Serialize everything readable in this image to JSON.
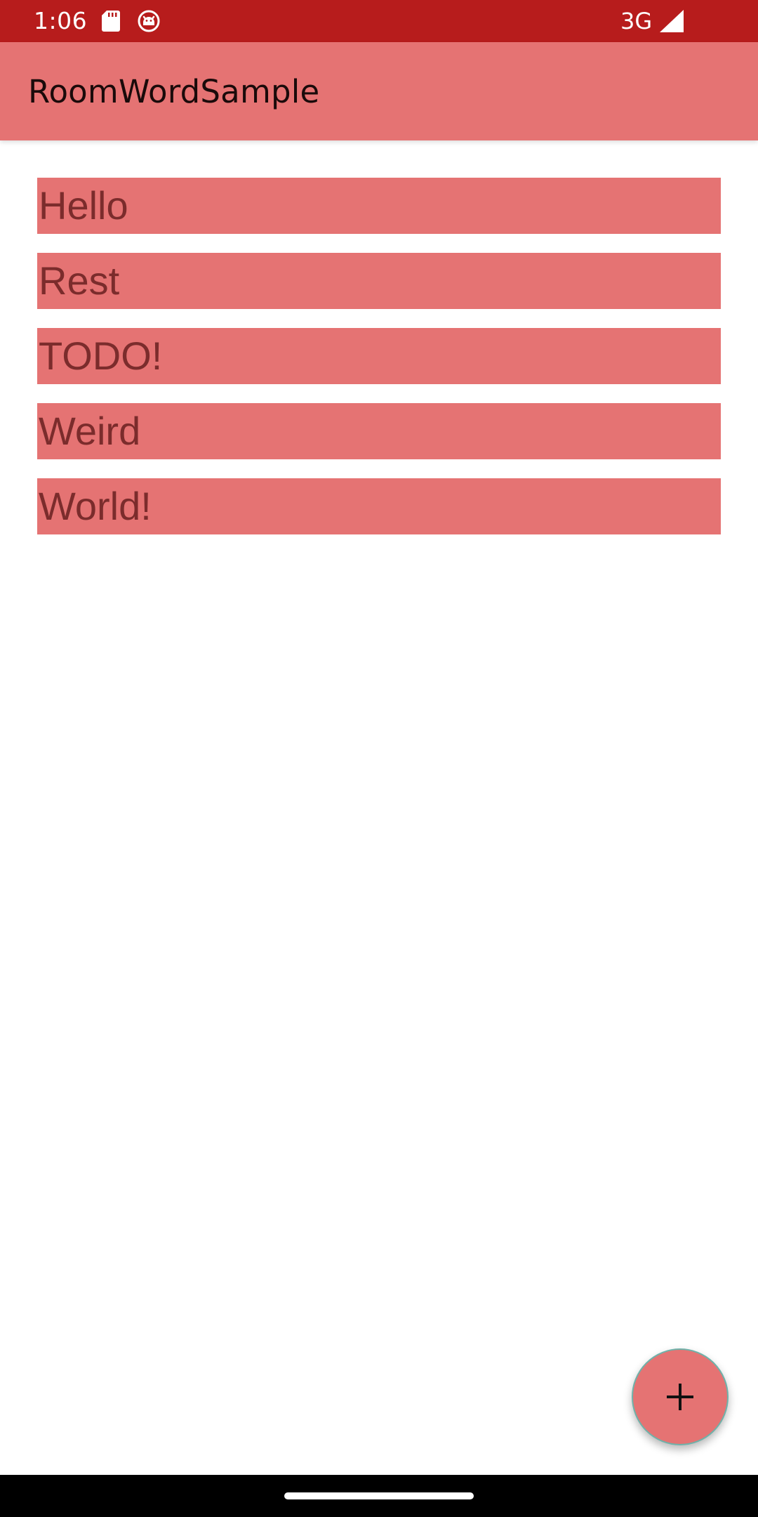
{
  "status_bar": {
    "time": "1:06",
    "network": "3G",
    "icons": [
      "sd-card-icon",
      "debug-icon",
      "cell-signal-icon"
    ],
    "color": "#b71c1c"
  },
  "app_bar": {
    "title": "RoomWordSample",
    "color": "#e57373"
  },
  "words": [
    {
      "label": "Hello"
    },
    {
      "label": "Rest"
    },
    {
      "label": "TODO!"
    },
    {
      "label": "Weird"
    },
    {
      "label": "World!"
    }
  ],
  "fab": {
    "icon": "plus-icon",
    "color": "#e57373"
  },
  "nav_bar": {
    "handle": "home-handle"
  }
}
